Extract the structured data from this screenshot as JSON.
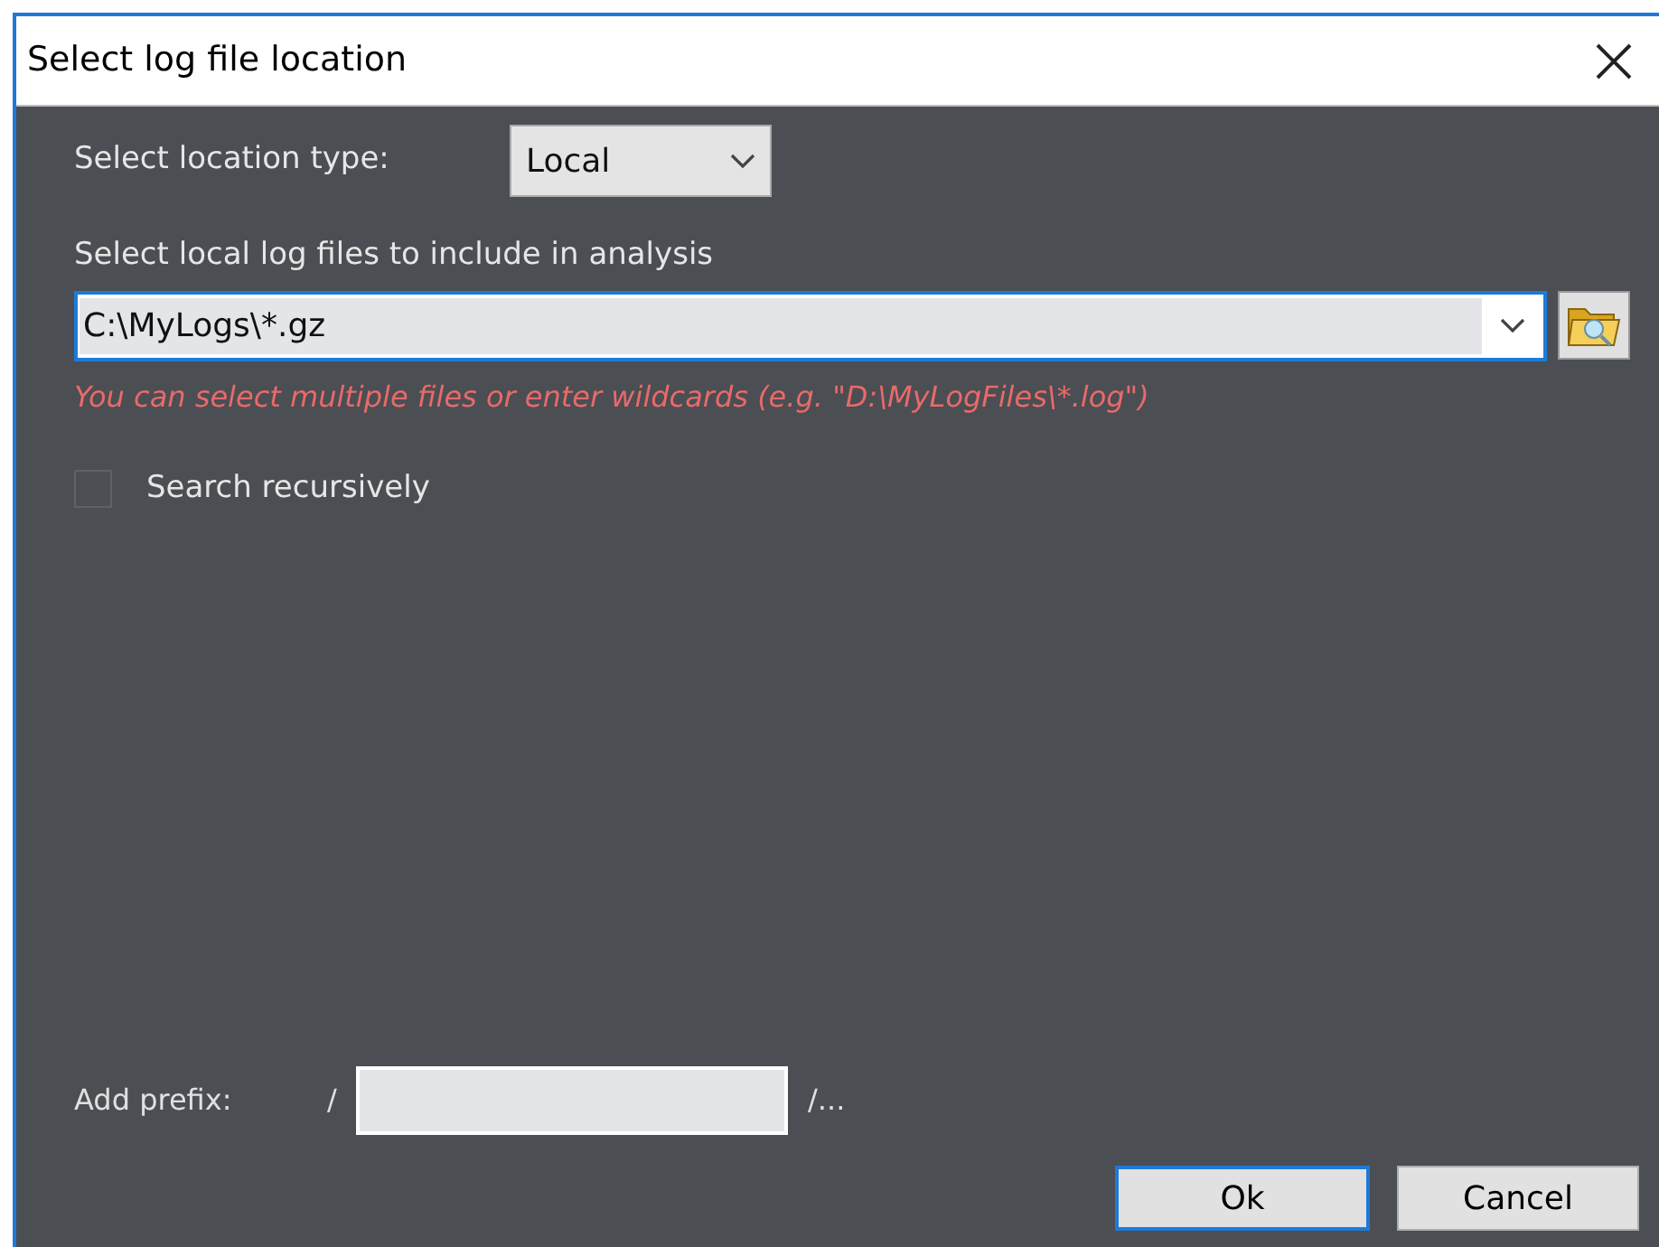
{
  "window": {
    "title": "Select log file location"
  },
  "location_type": {
    "label": "Select location type:",
    "value": "Local"
  },
  "files": {
    "label": "Select local log files to include in analysis",
    "value": "C:\\MyLogs\\*.gz",
    "hint": "You can select multiple files or enter wildcards (e.g. \"D:\\MyLogFiles\\*.log\")"
  },
  "search_recursively": {
    "label": "Search recursively",
    "checked": false
  },
  "prefix": {
    "label": "Add prefix:",
    "before": "/",
    "after": "/..."
  },
  "buttons": [
    {
      "label": "Ok",
      "default": true
    },
    {
      "label": "Cancel",
      "default": false
    }
  ]
}
